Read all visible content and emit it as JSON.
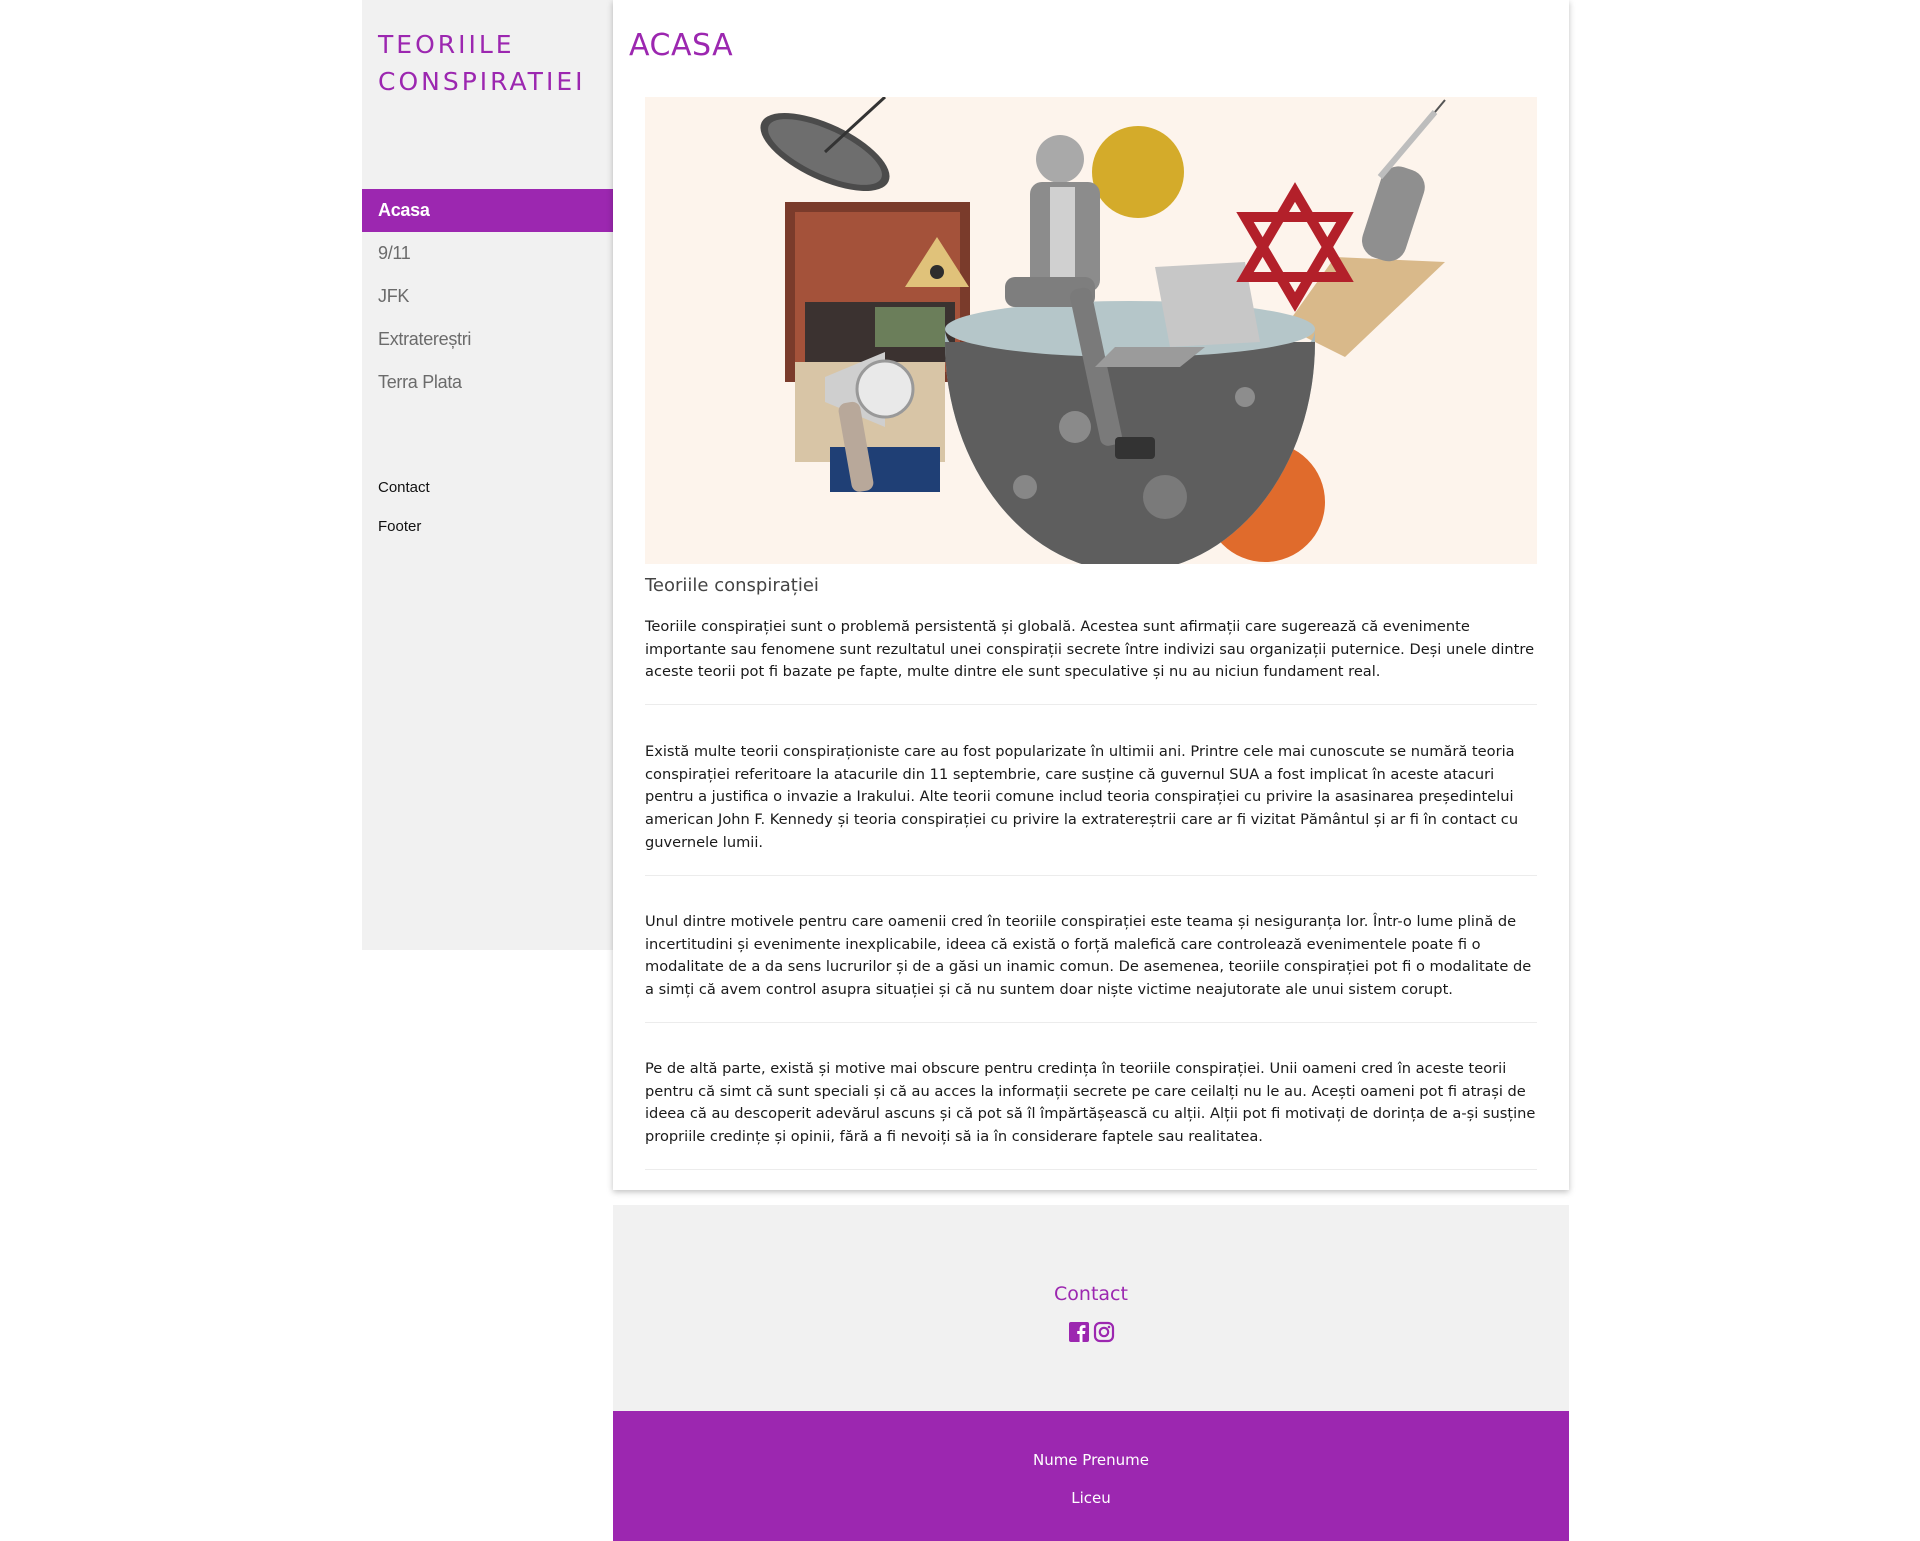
{
  "sidebar": {
    "brand_line1": "TEORIILE",
    "brand_line2": "CONSPIRATIEI",
    "nav": [
      {
        "label": "Acasa",
        "active": true
      },
      {
        "label": "9/11",
        "active": false
      },
      {
        "label": "JFK",
        "active": false
      },
      {
        "label": "Extratereștri",
        "active": false
      },
      {
        "label": "Terra Plata",
        "active": false
      }
    ],
    "links": [
      "Contact",
      "Footer"
    ]
  },
  "main": {
    "title": "ACASA",
    "hero_image": "conspiracy-collage-illustration",
    "section_title": "Teoriile conspirației",
    "paragraphs": [
      "Teoriile conspirației sunt o problemă persistentă și globală. Acestea sunt afirmații care sugerează că evenimente importante sau fenomene sunt rezultatul unei conspirații secrete între indivizi sau organizații puternice. Deși unele dintre aceste teorii pot fi bazate pe fapte, multe dintre ele sunt speculative și nu au niciun fundament real.",
      "Există multe teorii conspiraționiste care au fost popularizate în ultimii ani. Printre cele mai cunoscute se numără teoria conspirației referitoare la atacurile din 11 septembrie, care susține că guvernul SUA a fost implicat în aceste atacuri pentru a justifica o invazie a Irakului. Alte teorii comune includ teoria conspirației cu privire la asasinarea președintelui american John F. Kennedy și teoria conspirației cu privire la extratereștrii care ar fi vizitat Pământul și ar fi în contact cu guvernele lumii.",
      "Unul dintre motivele pentru care oamenii cred în teoriile conspirației este teama și nesiguranța lor. Într-o lume plină de incertitudini și evenimente inexplicabile, ideea că există o forță malefică care controlează evenimentele poate fi o modalitate de a da sens lucrurilor și de a găsi un inamic comun. De asemenea, teoriile conspirației pot fi o modalitate de a simți că avem control asupra situației și că nu suntem doar niște victime neajutorate ale unui sistem corupt.",
      "Pe de altă parte, există și motive mai obscure pentru credința în teoriile conspirației. Unii oameni cred în aceste teorii pentru că simt că sunt speciali și că au acces la informații secrete pe care ceilalți nu le au. Acești oameni pot fi atrași de ideea că au descoperit adevărul ascuns și că pot să îl împărtășească cu alții. Alții pot fi motivați de dorința de a-și susține propriile credințe și opinii, fără a fi nevoiți să ia în considerare faptele sau realitatea."
    ]
  },
  "contact": {
    "title": "Contact",
    "icons": [
      "facebook-icon",
      "instagram-icon"
    ]
  },
  "footer": {
    "name": "Nume Prenume",
    "school": "Liceu"
  },
  "colors": {
    "accent": "#9c27b0",
    "sidebar_bg": "#f1f1f1",
    "hero_bg": "#fdf4ec"
  }
}
